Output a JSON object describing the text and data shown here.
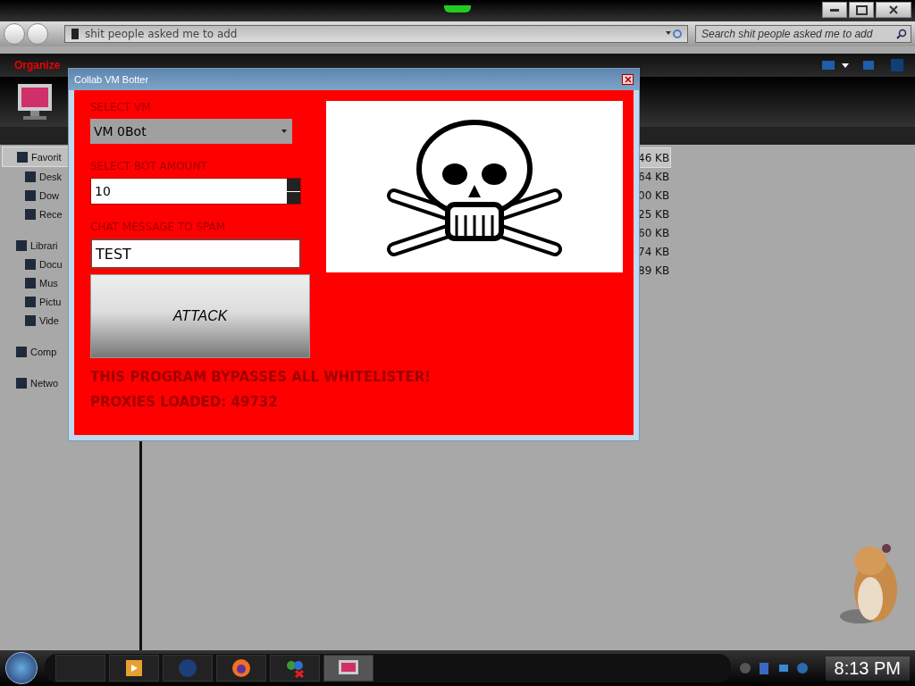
{
  "explorer": {
    "address": "shit people asked me to add",
    "search": {
      "placeholder": "Search shit people asked me to add"
    },
    "toolbar": [
      "Organize"
    ],
    "sidebar": [
      {
        "label": "Favorit",
        "kind": "group",
        "selected": true
      },
      {
        "label": "Desk",
        "kind": "item",
        "selected": false
      },
      {
        "label": "Dow",
        "kind": "item",
        "selected": false
      },
      {
        "label": "Rece",
        "kind": "item",
        "selected": false
      },
      {
        "label": "Librari",
        "kind": "group",
        "selected": false
      },
      {
        "label": "Docu",
        "kind": "item",
        "selected": false
      },
      {
        "label": "Mus",
        "kind": "item",
        "selected": false
      },
      {
        "label": "Pictu",
        "kind": "item",
        "selected": false
      },
      {
        "label": "Vide",
        "kind": "item",
        "selected": false
      },
      {
        "label": "Comp",
        "kind": "group",
        "selected": false
      },
      {
        "label": "Netwo",
        "kind": "group",
        "selected": false
      }
    ],
    "sizes": [
      {
        "text": "46 KB",
        "selected": true
      },
      {
        "text": "64 KB",
        "selected": false
      },
      {
        "text": "00 KB",
        "selected": false
      },
      {
        "text": "25 KB",
        "selected": false
      },
      {
        "text": "60 KB",
        "selected": false
      },
      {
        "text": "74 KB",
        "selected": false
      },
      {
        "text": "89 KB",
        "selected": false
      }
    ]
  },
  "dialog": {
    "title": "Collab VM Botter",
    "vm_label": "SELECT VM",
    "vm_value": "VM 0Bot",
    "amount_label": "SELECT BOT AMOUNT",
    "amount_value": "10",
    "message_label": "CHAT MESSAGE TO SPAM",
    "message_value": "TEST",
    "attack_button": "ATTACK",
    "notes": [
      "THIS PROGRAM BYPASSES ALL WHITELISTER!",
      "PROXIES LOADED: 49732"
    ]
  },
  "taskbar": {
    "clock": "8:13 PM"
  }
}
